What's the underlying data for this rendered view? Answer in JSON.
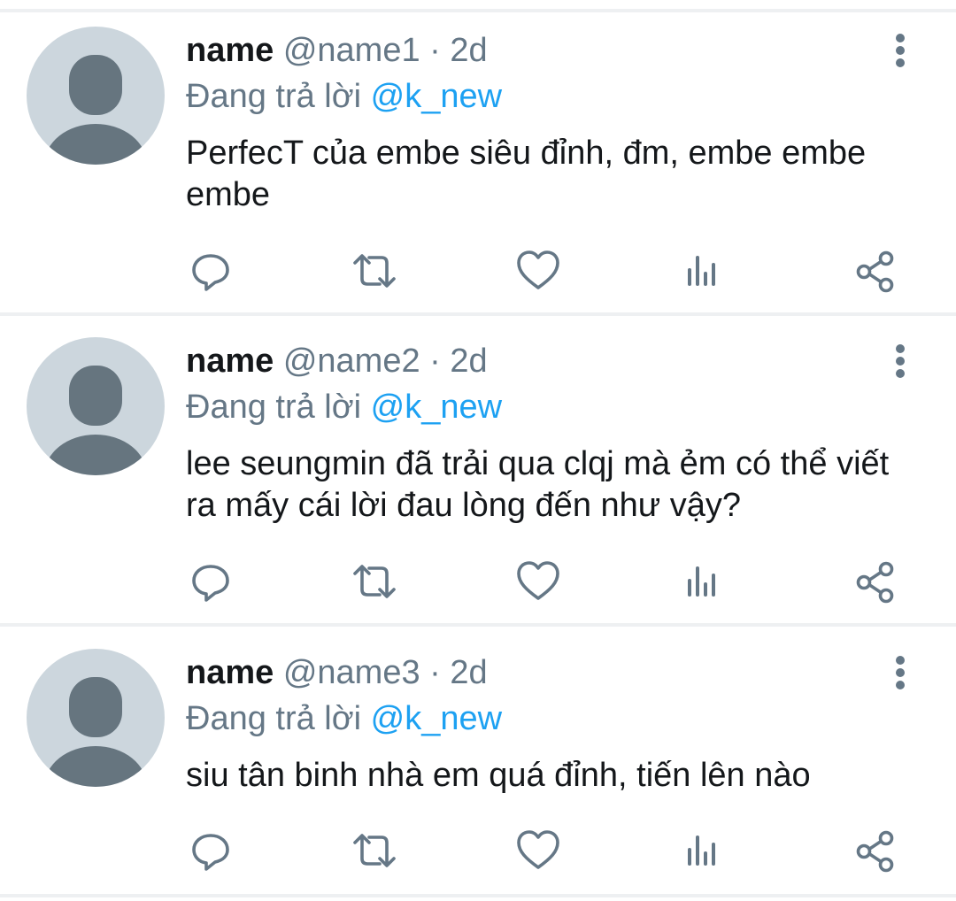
{
  "colors": {
    "link": "#1da1f2",
    "secondary_text": "#657786",
    "icon": "#657786",
    "avatar_bg": "#ccd6dd",
    "avatar_fg": "#66757f",
    "divider": "#eef0f2"
  },
  "tweets": [
    {
      "name": "name",
      "handle": "@name1",
      "separator": "·",
      "time": "2d",
      "reply_prefix": "Đang trả lời",
      "reply_mention": "@k_new",
      "text": "PerfecT của embe siêu đỉnh, đm, embe embe embe",
      "icons": [
        "more-vertical-icon",
        "reply-icon",
        "retweet-icon",
        "like-icon",
        "analytics-icon",
        "share-icon"
      ]
    },
    {
      "name": "name",
      "handle": "@name2",
      "separator": "·",
      "time": "2d",
      "reply_prefix": "Đang trả lời",
      "reply_mention": "@k_new",
      "text": "lee seungmin đã trải qua clqj mà ẻm có thể viết ra mấy cái lời đau lòng đến như vậy?",
      "icons": [
        "more-vertical-icon",
        "reply-icon",
        "retweet-icon",
        "like-icon",
        "analytics-icon",
        "share-icon"
      ]
    },
    {
      "name": "name",
      "handle": "@name3",
      "separator": "·",
      "time": "2d",
      "reply_prefix": "Đang trả lời",
      "reply_mention": "@k_new",
      "text": "siu tân binh nhà em quá đỉnh, tiến lên nào",
      "icons": [
        "more-vertical-icon",
        "reply-icon",
        "retweet-icon",
        "like-icon",
        "analytics-icon",
        "share-icon"
      ]
    }
  ]
}
